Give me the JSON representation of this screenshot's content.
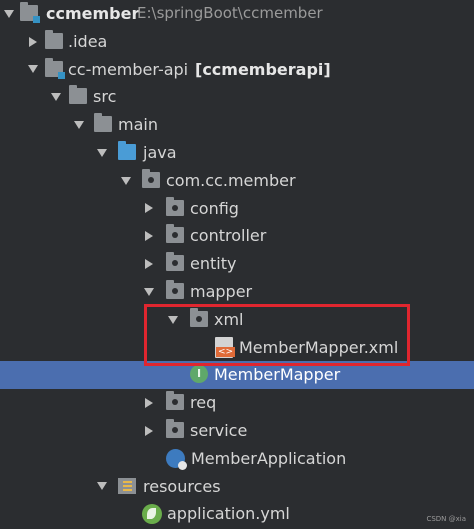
{
  "tree": {
    "root": {
      "name": "ccmember",
      "path": "E:\\springBoot\\ccmember"
    },
    "idea": "idea",
    "module": {
      "name": "cc-member-api",
      "tag": "[ccmemberapi]"
    },
    "src": "src",
    "main": "main",
    "java": "java",
    "package": "com.cc.member",
    "config": "config",
    "controller": "controller",
    "entity": "entity",
    "mapper": "mapper",
    "xml": "xml",
    "xml_file": "MemberMapper.xml",
    "mapper_interface": "MemberMapper",
    "interface_badge": "I",
    "req": "req",
    "service": "service",
    "application_class": "MemberApplication",
    "resources": "resources",
    "application_yml": "application.yml"
  },
  "watermark": "CSDN @xia",
  "colors": {
    "background": "#2b2d30",
    "selection": "#4b6eaf",
    "highlight_border": "#e0262f",
    "java_folder": "#4a9cd6"
  }
}
